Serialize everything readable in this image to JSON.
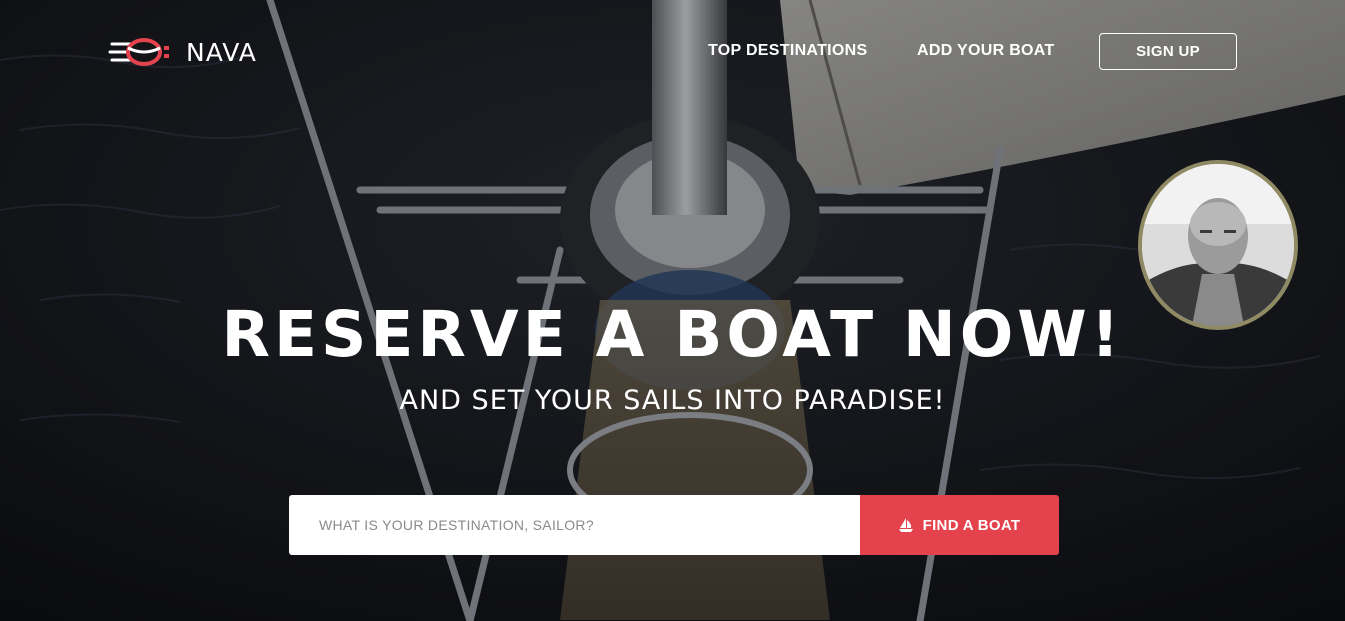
{
  "brand": {
    "name": "NAVA",
    "logo_icon": "knot-logo-icon"
  },
  "nav": {
    "top_destinations": "TOP DESTINATIONS",
    "add_boat": "ADD YOUR BOAT",
    "sign_up": "SIGN UP"
  },
  "hero": {
    "headline": "RESERVE A BOAT NOW!",
    "subheadline": "AND SET YOUR SAILS INTO PARADISE!",
    "background": "sailboat-bow-photo"
  },
  "search": {
    "placeholder": "WHAT IS YOUR DESTINATION, SAILOR?",
    "value": "",
    "button_label": "FIND A BOAT",
    "button_icon": "sailboat-icon"
  },
  "avatar": {
    "icon": "user-avatar"
  },
  "colors": {
    "accent": "#e4424d",
    "text": "#ffffff",
    "avatar_border": "#8f8a63"
  }
}
